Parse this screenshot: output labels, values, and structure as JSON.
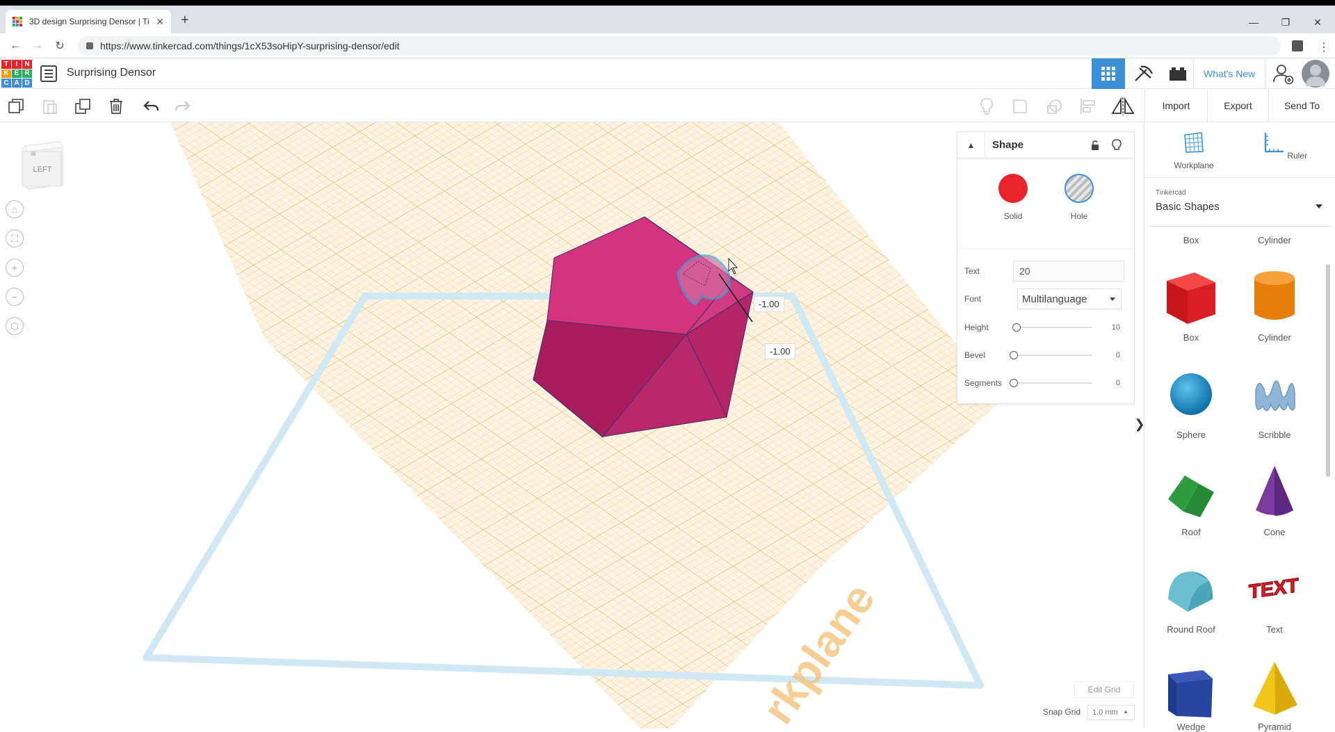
{
  "browser": {
    "tab_title": "3D design Surprising Densor | Ti",
    "url": "https://www.tinkercad.com/things/1cX53soHipY-surprising-densor/edit"
  },
  "app": {
    "logo_letters": [
      "T",
      "I",
      "N",
      "K",
      "E",
      "R",
      "C",
      "A",
      "D"
    ],
    "design_title": "Surprising Densor",
    "whats_new": "What's New"
  },
  "toolbar": {
    "import": "Import",
    "export": "Export",
    "send_to": "Send To"
  },
  "viewport": {
    "viewcube_face": "LEFT",
    "dim_a": "-1.00",
    "dim_b": "-1.00",
    "workplane_text": "rkplane",
    "edit_grid": "Edit Grid",
    "snap_grid_label": "Snap Grid",
    "snap_grid_value": "1.0 mm"
  },
  "shape_panel": {
    "title": "Shape",
    "solid": "Solid",
    "hole": "Hole",
    "text_label": "Text",
    "text_value": "20",
    "font_label": "Font",
    "font_value": "Multilanguage",
    "height_label": "Height",
    "height_value": "10",
    "bevel_label": "Bevel",
    "bevel_value": "0",
    "segments_label": "Segments",
    "segments_value": "0"
  },
  "sidebar": {
    "workplane": "Workplane",
    "ruler": "Ruler",
    "library_source": "Tinkercad",
    "library_name": "Basic Shapes",
    "partial_labels": [
      "Box",
      "Cylinder"
    ],
    "shapes": [
      {
        "label": "Box"
      },
      {
        "label": "Cylinder"
      },
      {
        "label": "Sphere"
      },
      {
        "label": "Scribble"
      },
      {
        "label": "Roof"
      },
      {
        "label": "Cone"
      },
      {
        "label": "Round Roof"
      },
      {
        "label": "Text"
      },
      {
        "label": "Wedge"
      },
      {
        "label": "Pyramid"
      }
    ]
  },
  "colors": {
    "solid_red": "#e8232a",
    "accent_blue": "#3d8fd6",
    "shape_magenta": "#c2185b",
    "grid_orange": "#f5b85a"
  }
}
